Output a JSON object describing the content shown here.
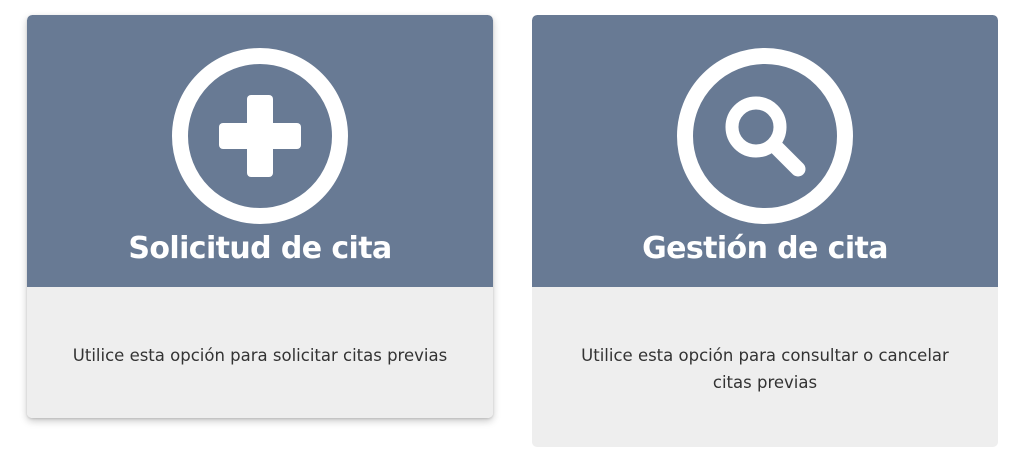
{
  "cards": [
    {
      "title": "Solicitud de cita",
      "description": "Utilice esta opción para solicitar citas previas",
      "icon": "plus-circle-icon"
    },
    {
      "title": "Gestión de cita",
      "description": "Utilice esta opción para consultar o cancelar citas previas",
      "icon": "search-circle-icon"
    }
  ],
  "colors": {
    "header_background": "#687a94",
    "body_background": "#eeeeee",
    "title_text": "#ffffff",
    "description_text": "#333333"
  }
}
